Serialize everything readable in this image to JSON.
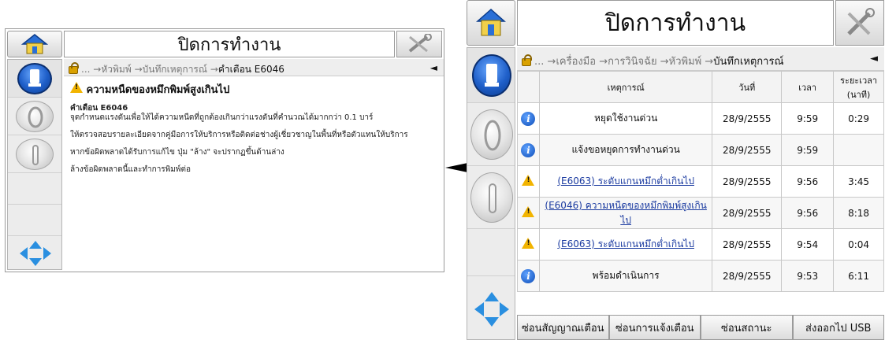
{
  "left_panel": {
    "title": "ปิดการทำงาน",
    "breadcrumb": {
      "prefix": "...",
      "items": [
        "หัวพิมพ์",
        "บันทึกเหตุการณ์"
      ],
      "current": "คำเตือน E6046",
      "back": "◄"
    },
    "message": {
      "heading": "ความหนืดของหมึกพิมพ์สูงเกินไป",
      "code": "คำเตือน E6046",
      "line1": "จุดกำหนดแรงดันเพื่อให้ได้ความหนืดที่ถูกต้องเกินกว่าแรงดันที่คำนวณได้มากกว่า 0.1 บาร์",
      "line2": "ให้ตรวจสอบรายละเอียดจากคู่มือการให้บริการหรือติดต่อช่างผู้เชี่ยวชาญในพื้นที่หรือตัวแทนให้บริการ",
      "line3": "หากข้อผิดพลาดได้รับการแก้ไข ปุ่ม \"ล้าง\" จะปรากฏขึ้นด้านล่าง",
      "line4": "ล้างข้อผิดพลาดนี้และทำการพิมพ์ต่อ"
    }
  },
  "right_panel": {
    "title": "ปิดการทำงาน",
    "breadcrumb": {
      "prefix": "...",
      "items": [
        "เครื่องมือ",
        "การวินิจฉัย",
        "หัวพิมพ์"
      ],
      "current": "บันทึกเหตุการณ์",
      "back": "◄"
    },
    "table": {
      "headers": {
        "event": "เหตุการณ์",
        "date": "วันที่",
        "time": "เวลา",
        "duration": "ระยะเวลา (นาที)"
      },
      "rows": [
        {
          "icon": "info-icon",
          "event": "หยุดใช้งานด่วน",
          "date": "28/9/2555",
          "time": "9:59",
          "duration": "0:29",
          "link": false
        },
        {
          "icon": "info-icon",
          "event": "แจ้งขอหยุดการทำงานด่วน",
          "date": "28/9/2555",
          "time": "9:59",
          "duration": "",
          "link": false
        },
        {
          "icon": "warning-icon",
          "event": "(E6063) ระดับแกนหมึกต่ำเกินไป",
          "date": "28/9/2555",
          "time": "9:56",
          "duration": "3:45",
          "link": true
        },
        {
          "icon": "warning-icon",
          "event": "(E6046) ความหนืดของหมึกพิมพ์สูงเกินไป",
          "date": "28/9/2555",
          "time": "9:56",
          "duration": "8:18",
          "link": true
        },
        {
          "icon": "warning-icon",
          "event": "(E6063) ระดับแกนหมึกต่ำเกินไป",
          "date": "28/9/2555",
          "time": "9:54",
          "duration": "0:04",
          "link": true
        },
        {
          "icon": "info-icon",
          "event": "พร้อมดำเนินการ",
          "date": "28/9/2555",
          "time": "9:53",
          "duration": "6:11",
          "link": false
        }
      ]
    },
    "bottom_buttons": [
      "ซ่อนสัญญาณเตือน",
      "ซ่อนการแจ้งเตือน",
      "ซ่อนสถานะ",
      "ส่งออกไป USB"
    ]
  },
  "colors": {
    "link": "#1a3aa0",
    "warning": "#f2b400",
    "info": "#0e4db8"
  }
}
